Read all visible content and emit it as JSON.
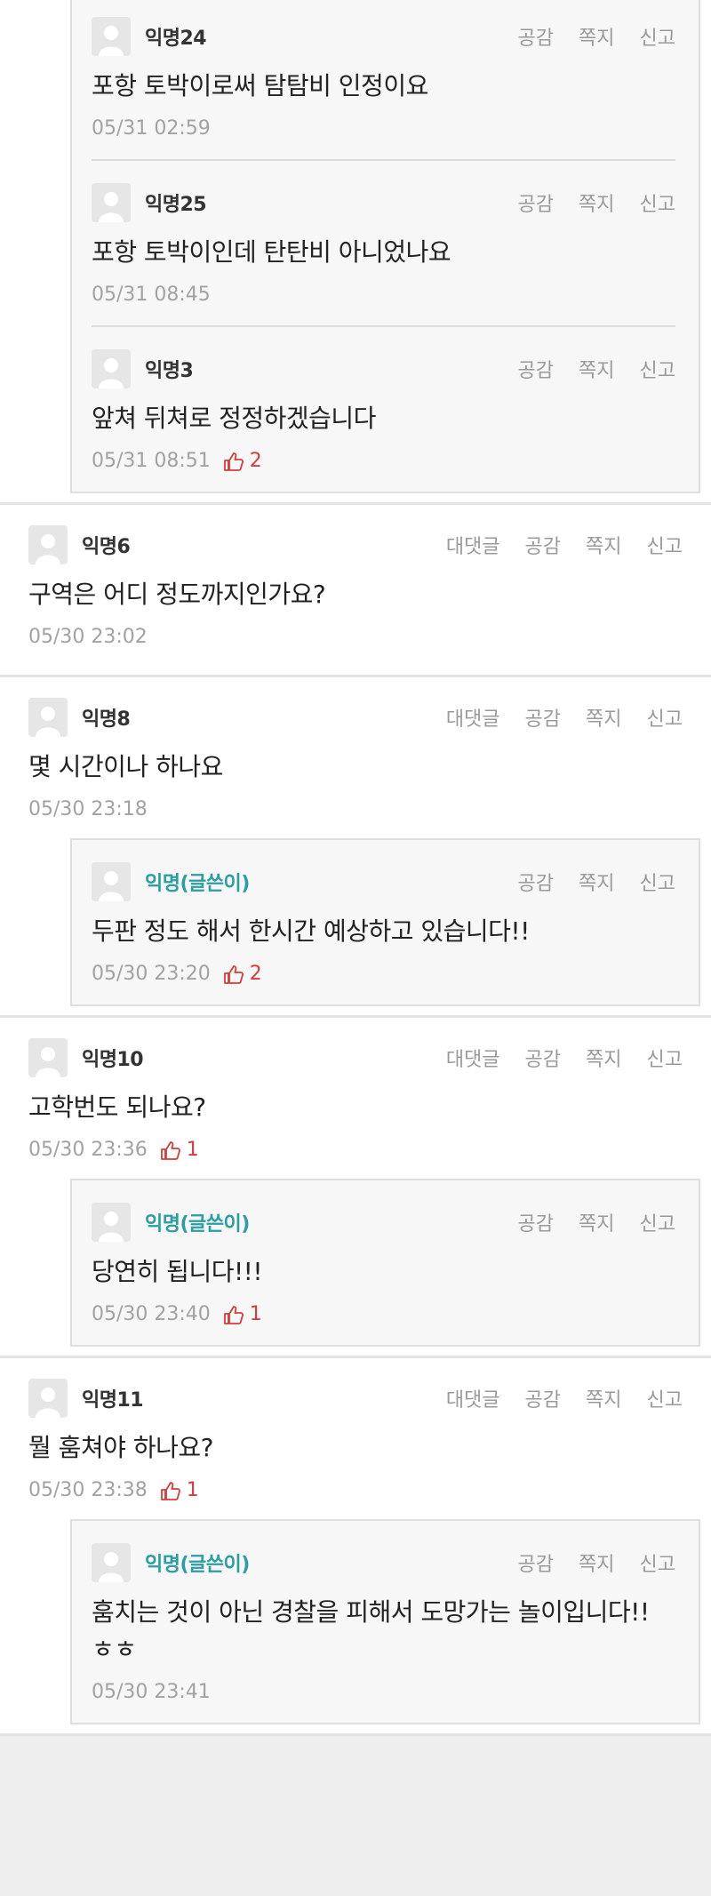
{
  "labels": {
    "reply": "대댓글",
    "empathy": "공감",
    "message": "쪽지",
    "report": "신고"
  },
  "threads": [
    {
      "top": null,
      "replies": [
        {
          "author": "익명24",
          "op": false,
          "text": "포항 토박이로써 탐탐비 인정이요",
          "time": "05/31 02:59",
          "likes": ""
        },
        {
          "author": "익명25",
          "op": false,
          "text": "포항 토박이인데 탄탄비 아니었나요",
          "time": "05/31 08:45",
          "likes": ""
        },
        {
          "author": "익명3",
          "op": false,
          "text": "앞쳐 뒤쳐로 정정하겠습니다",
          "time": "05/31 08:51",
          "likes": "2"
        }
      ]
    },
    {
      "top": {
        "author": "익명6",
        "text": "구역은 어디 정도까지인가요?",
        "time": "05/30 23:02",
        "likes": ""
      },
      "replies": []
    },
    {
      "top": {
        "author": "익명8",
        "text": "몇 시간이나 하나요",
        "time": "05/30 23:18",
        "likes": ""
      },
      "replies": [
        {
          "author": "익명(글쓴이)",
          "op": true,
          "text": "두판 정도 해서 한시간 예상하고 있습니다!!",
          "time": "05/30 23:20",
          "likes": "2"
        }
      ]
    },
    {
      "top": {
        "author": "익명10",
        "text": "고학번도 되나요?",
        "time": "05/30 23:36",
        "likes": "1"
      },
      "replies": [
        {
          "author": "익명(글쓴이)",
          "op": true,
          "text": "당연히 됩니다!!!",
          "time": "05/30 23:40",
          "likes": "1"
        }
      ]
    },
    {
      "top": {
        "author": "익명11",
        "text": "뭘 훔쳐야 하나요?",
        "time": "05/30 23:38",
        "likes": "1"
      },
      "replies": [
        {
          "author": "익명(글쓴이)",
          "op": true,
          "text": "훔치는 것이 아닌 경찰을 피해서 도망가는 놀이입니다!!ㅎㅎ",
          "time": "05/30 23:41",
          "likes": ""
        }
      ]
    }
  ]
}
